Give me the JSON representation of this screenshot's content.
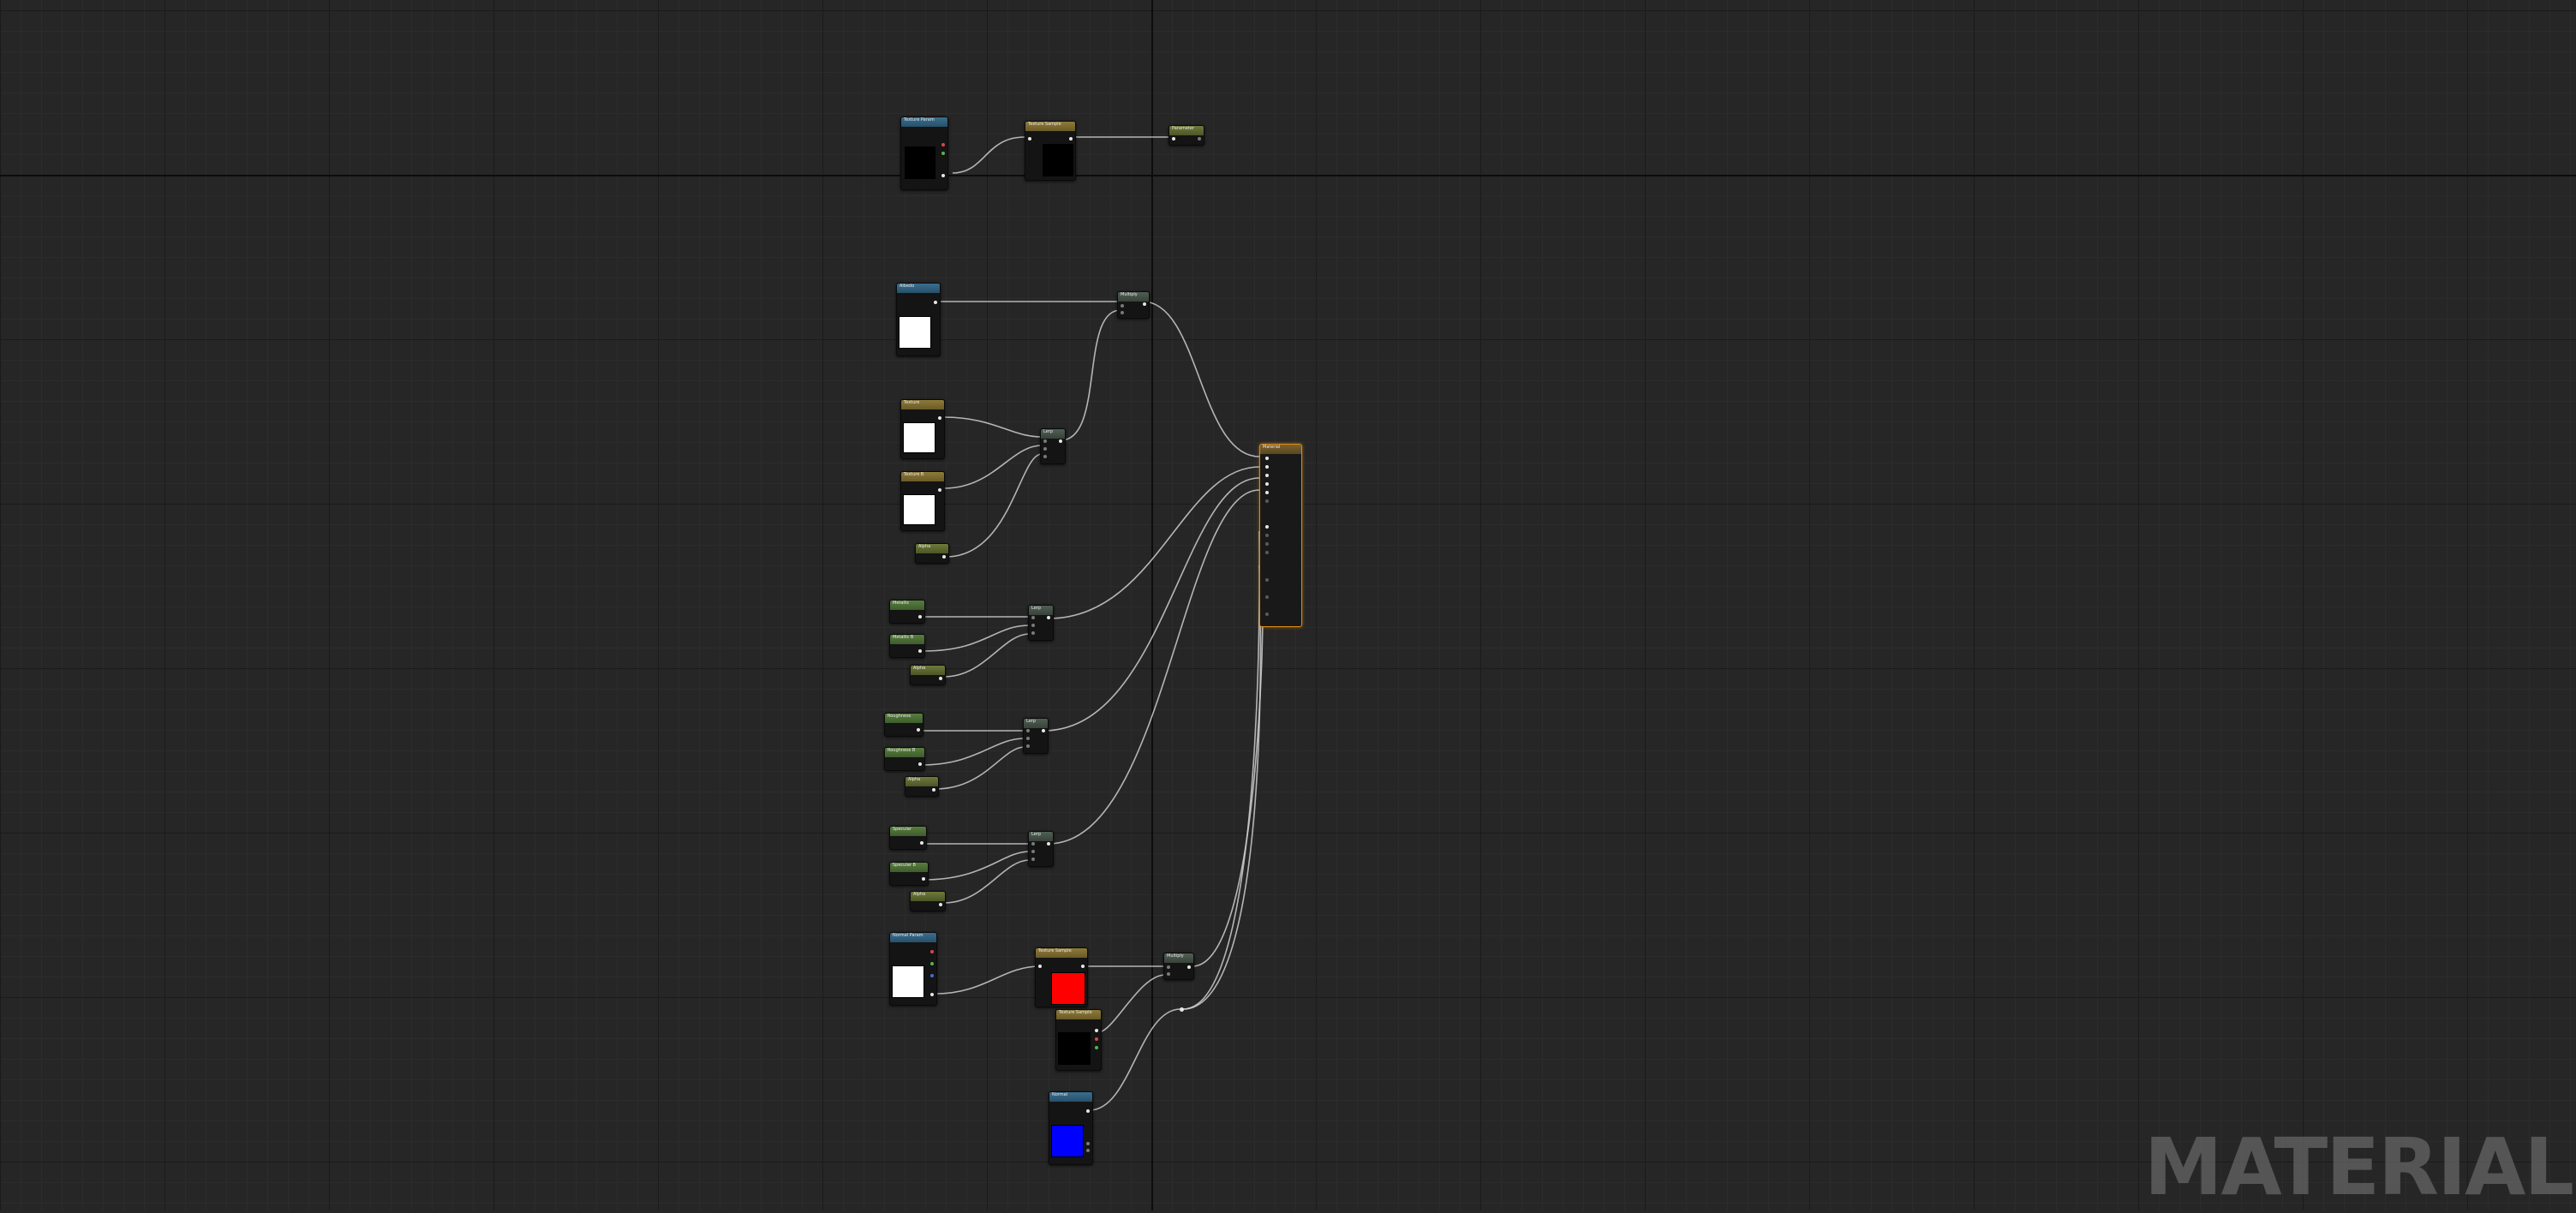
{
  "graph": {
    "watermark": "MATERIAL",
    "colors": {
      "background": "#262626",
      "wire": "#cfcfcf",
      "result_outline": "#e08a16",
      "parameter_header": "#3a6e8e",
      "texture_header": "#8e7a3a",
      "scalar_header": "#587d3f",
      "math_header": "#4f5f55"
    },
    "nodes": {
      "tex_param_top": {
        "title": "Texture Param",
        "subtitle": "Param2D",
        "preview": "#000000"
      },
      "tex_sample_top": {
        "title": "Texture Sample",
        "subtitle": "",
        "preview": "#000000"
      },
      "small_output_top": {
        "title": "Parameter",
        "subtitle": ""
      },
      "albedo_param": {
        "title": "Albedo",
        "subtitle": "Param2D",
        "preview": "#ffffff"
      },
      "multiply_albedo": {
        "title": "Multiply",
        "subtitle": ""
      },
      "texture_a": {
        "title": "Texture",
        "subtitle": "Sample",
        "preview": "#ffffff"
      },
      "texture_b": {
        "title": "Texture B",
        "subtitle": "Sample",
        "preview": "#ffffff"
      },
      "scalar_lerp": {
        "title": "Alpha",
        "subtitle": ""
      },
      "lerp_a": {
        "title": "Lerp",
        "subtitle": ""
      },
      "metallic_a": {
        "title": "Metallic",
        "subtitle": ""
      },
      "metallic_b": {
        "title": "Metallic B",
        "subtitle": ""
      },
      "metallic_alpha": {
        "title": "Alpha",
        "subtitle": ""
      },
      "lerp_metallic": {
        "title": "Lerp",
        "subtitle": ""
      },
      "roughness_a": {
        "title": "Roughness",
        "subtitle": ""
      },
      "roughness_b": {
        "title": "Roughness B",
        "subtitle": ""
      },
      "roughness_alpha": {
        "title": "Alpha",
        "subtitle": ""
      },
      "lerp_roughness": {
        "title": "Lerp",
        "subtitle": ""
      },
      "specular_a": {
        "title": "Specular",
        "subtitle": ""
      },
      "specular_b": {
        "title": "Specular B",
        "subtitle": ""
      },
      "specular_alpha": {
        "title": "Alpha",
        "subtitle": ""
      },
      "lerp_specular": {
        "title": "Lerp",
        "subtitle": ""
      },
      "normal_param": {
        "title": "Normal Param",
        "subtitle": "Param2D",
        "preview": "#ffffff"
      },
      "normal_sample": {
        "title": "Texture Sample",
        "subtitle": "",
        "preview": "#ff0000"
      },
      "multiply_normal": {
        "title": "Multiply",
        "subtitle": ""
      },
      "texture_dark": {
        "title": "Texture Sample",
        "subtitle": "",
        "preview": "#000000"
      },
      "normal_blue": {
        "title": "Normal",
        "subtitle": "Param2D",
        "preview": "#0000ff"
      },
      "material_result": {
        "title": "Material",
        "subtitle": ""
      }
    }
  }
}
